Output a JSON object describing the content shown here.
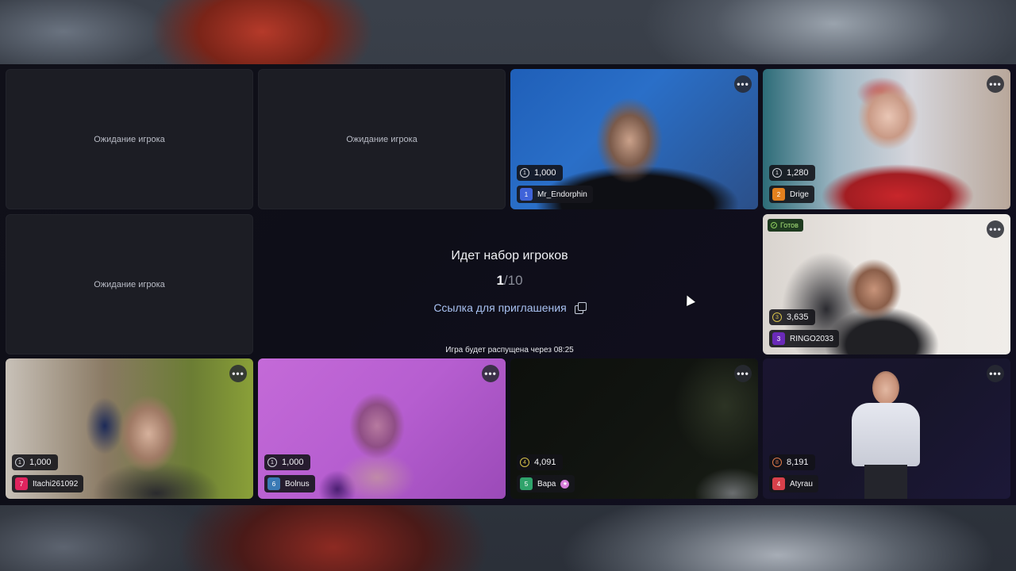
{
  "waiting_label": "Ожидание игрока",
  "lobby": {
    "title": "Идет набор игроков",
    "count_current": "1",
    "count_total": "/10",
    "invite_label": "Ссылка для приглашения",
    "dissolve_text": "Игра будет распущена через 08:25"
  },
  "ready_label": "Готов",
  "more_label": "•••",
  "players": [
    {
      "seat": "1",
      "name": "Mr_Endorphin",
      "score": "1,000",
      "level": "1",
      "color": "#3f63d9"
    },
    {
      "seat": "2",
      "name": "Drige",
      "score": "1,280",
      "level": "1",
      "color": "#e3801e"
    },
    {
      "seat": "3",
      "name": "RINGO2033",
      "score": "3,635",
      "level": "3",
      "color": "#6a2ab8"
    },
    {
      "seat": "7",
      "name": "Itachi261092",
      "score": "1,000",
      "level": "1",
      "color": "#e0245e"
    },
    {
      "seat": "6",
      "name": "Bolnus",
      "score": "1,000",
      "level": "1",
      "color": "#3a7ab5"
    },
    {
      "seat": "5",
      "name": "Bapa",
      "score": "4,091",
      "level": "4",
      "color": "#2fa36b"
    },
    {
      "seat": "4",
      "name": "Atyrau",
      "score": "8,191",
      "level": "8",
      "color": "#d8404a"
    }
  ]
}
